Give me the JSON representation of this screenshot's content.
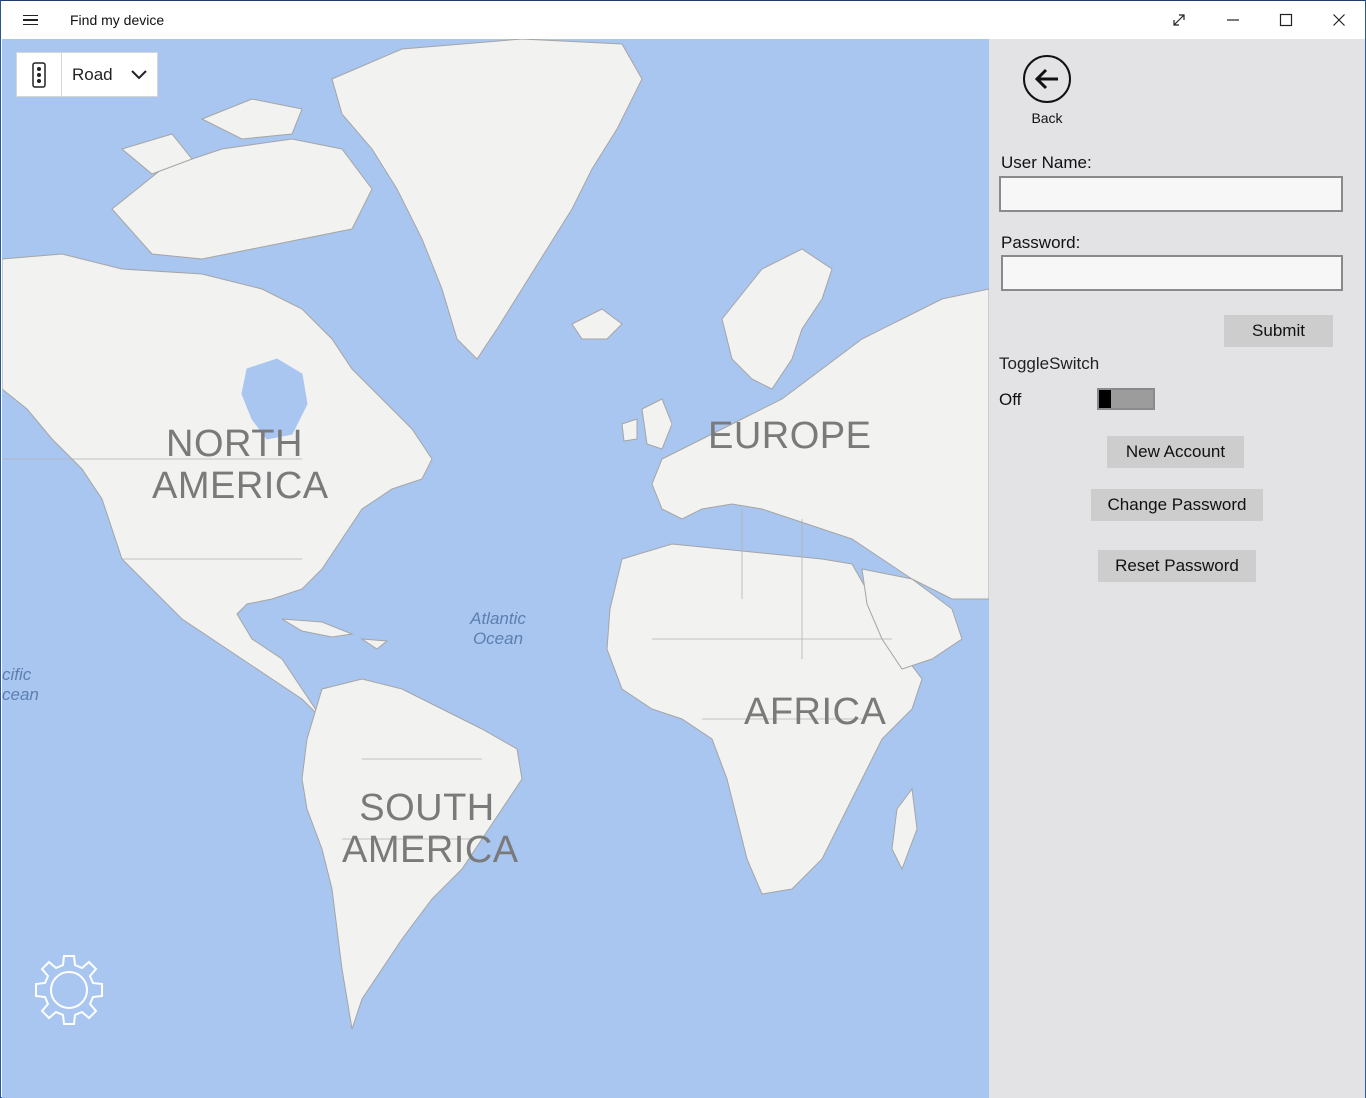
{
  "window": {
    "title": "Find my device"
  },
  "map": {
    "style_selected": "Road",
    "labels": {
      "north_america_line1": "NORTH",
      "north_america_line2": "AMERICA",
      "south_america_line1": "SOUTH",
      "south_america_line2": "AMERICA",
      "europe": "EUROPE",
      "africa": "AFRICA",
      "atlantic_line1": "Atlantic",
      "atlantic_line2": "Ocean",
      "pacific_line1": "cific",
      "pacific_line2": "cean"
    },
    "colors": {
      "water": "#a9c6f0",
      "land": "#f2f2f0",
      "border": "#9a9a9a"
    }
  },
  "panel": {
    "back_label": "Back",
    "username_label": "User Name:",
    "username_value": "",
    "password_label": "Password:",
    "password_value": "",
    "submit_label": "Submit",
    "toggle_header": "ToggleSwitch",
    "toggle_state": "Off",
    "new_account_label": "New Account",
    "change_password_label": "Change Password",
    "reset_password_label": "Reset Password"
  },
  "icons": {
    "menu": "hamburger-icon",
    "fullscreen": "expand-icon",
    "minimize": "minimize-icon",
    "maximize": "maximize-icon",
    "close": "close-icon",
    "traffic": "traffic-light-icon",
    "dropdown": "chevron-down-icon",
    "back": "arrow-left-icon",
    "settings": "gear-icon"
  }
}
